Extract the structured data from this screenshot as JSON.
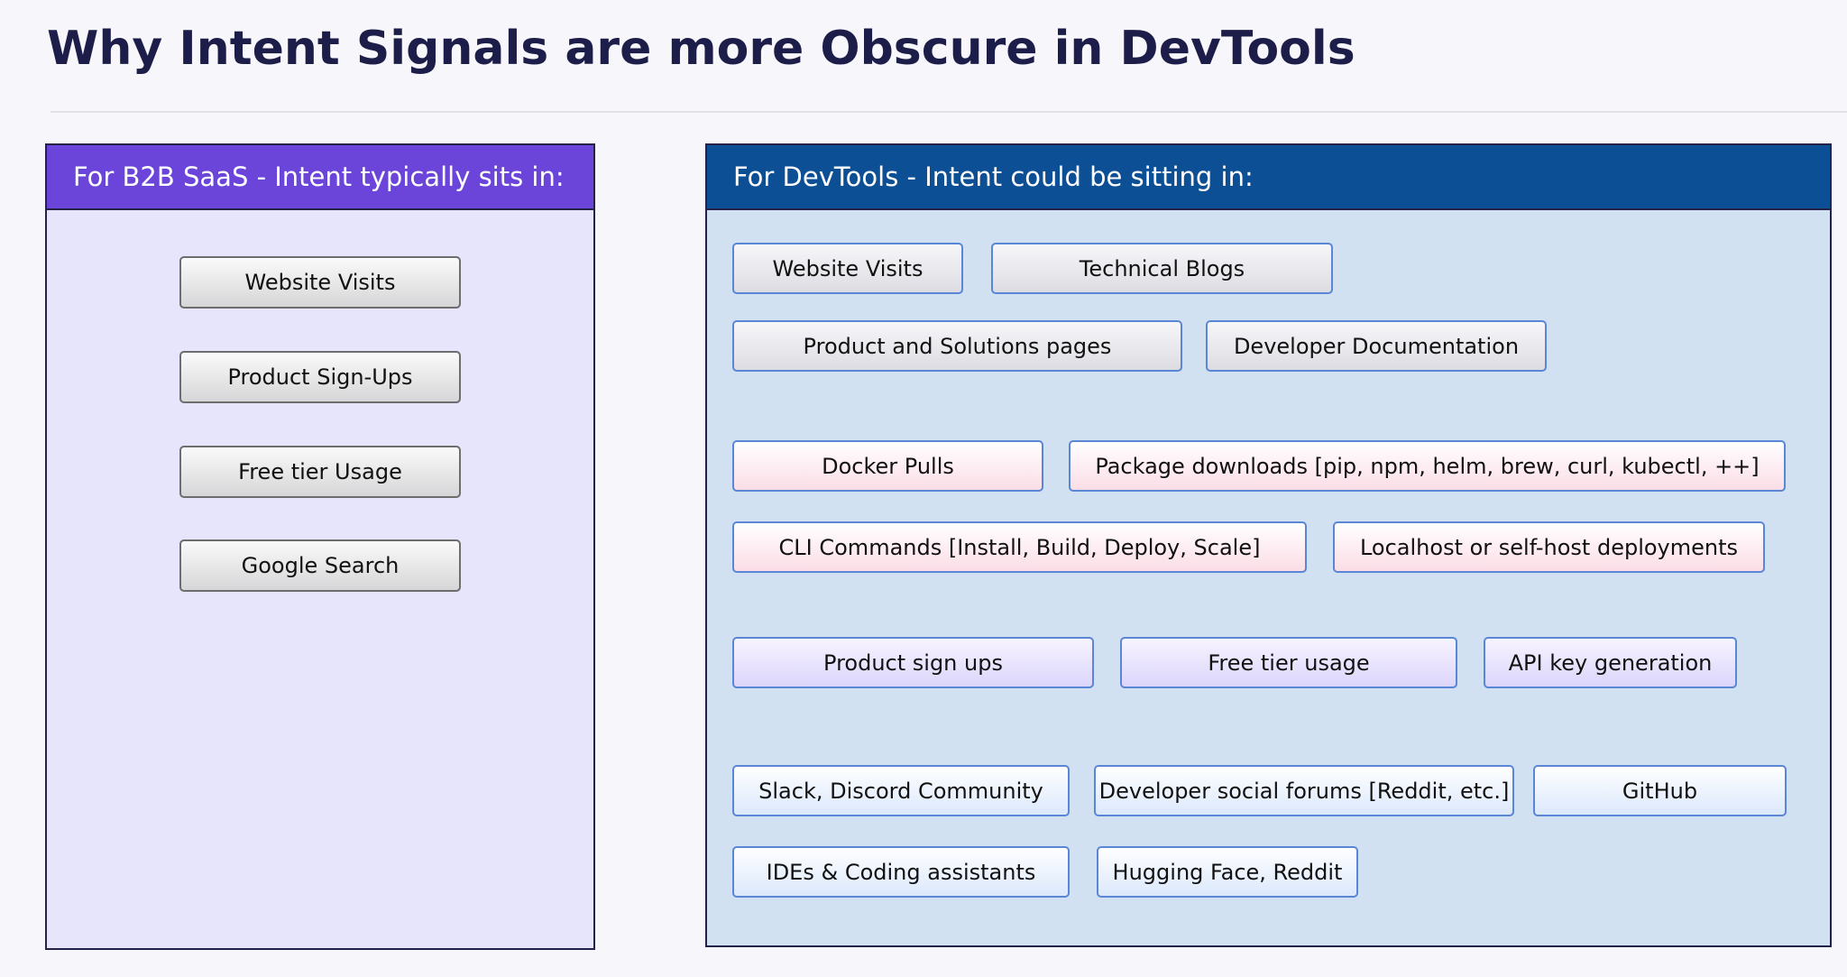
{
  "title": "Why Intent Signals are more Obscure in DevTools",
  "colors": {
    "b2b_header": "#6b45da",
    "b2b_panel": "#e7e5fc",
    "devtools_header": "#0d4f94",
    "devtools_panel": "#d1e1f2",
    "chip_border": "#5a86d6"
  },
  "b2b_saas": {
    "header": "For B2B SaaS - Intent typically sits in:",
    "items": [
      "Website Visits",
      "Product Sign-Ups",
      "Free tier Usage",
      "Google Search"
    ]
  },
  "devtools": {
    "header": "For DevTools - Intent could be sitting in:",
    "web_content": [
      "Website Visits",
      "Technical Blogs",
      "Product and Solutions pages",
      "Developer Documentation"
    ],
    "technical_usage": [
      "Docker Pulls",
      "Package downloads [pip, npm, helm, brew, curl, kubectl, ++]",
      "CLI Commands [Install, Build, Deploy, Scale]",
      "Localhost or self-host deployments"
    ],
    "product_usage": [
      "Product sign ups",
      "Free tier usage",
      "API key generation"
    ],
    "community": [
      "Slack, Discord Community",
      "Developer social forums [Reddit, etc.]",
      "GitHub",
      "IDEs & Coding assistants",
      "Hugging Face, Reddit"
    ]
  }
}
